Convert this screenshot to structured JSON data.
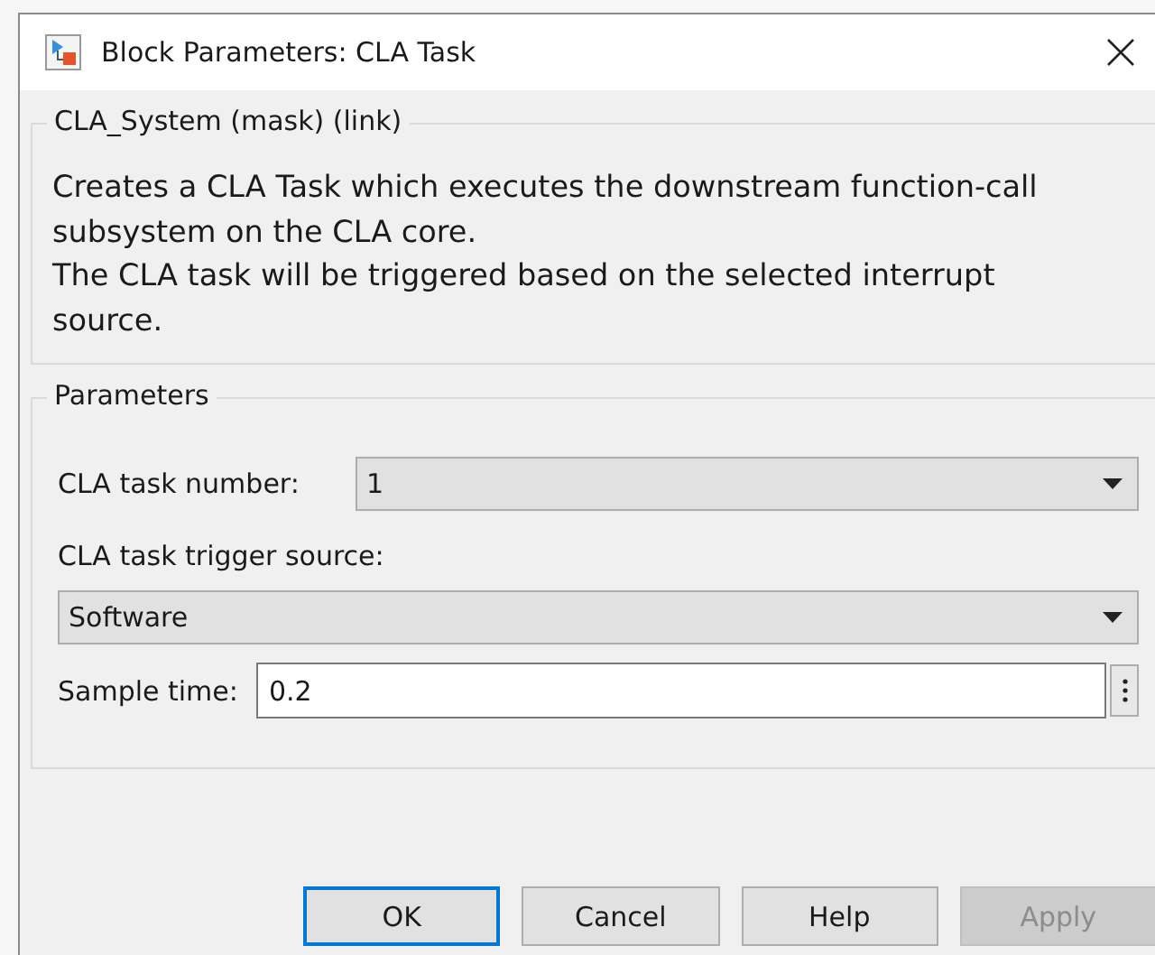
{
  "window": {
    "title": "Block Parameters: CLA Task"
  },
  "description_group": {
    "title": "CLA_System (mask) (link)",
    "lines": [
      "Creates a CLA Task which executes the downstream function-call subsystem on the CLA core.",
      "The CLA task will be triggered based on the selected interrupt source."
    ]
  },
  "parameters_group": {
    "title": "Parameters",
    "fields": [
      {
        "kind": "inline_dropdown",
        "label": "CLA task number:",
        "value": "1"
      },
      {
        "kind": "stacked_dropdown",
        "label": "CLA task trigger source:",
        "value": "Software"
      },
      {
        "kind": "text",
        "label": "Sample time:",
        "value": "0.2"
      }
    ]
  },
  "buttons": [
    {
      "label": "OK",
      "focused": true,
      "disabled": false
    },
    {
      "label": "Cancel",
      "focused": false,
      "disabled": false
    },
    {
      "label": "Help",
      "focused": false,
      "disabled": false
    },
    {
      "label": "Apply",
      "focused": false,
      "disabled": true
    }
  ]
}
